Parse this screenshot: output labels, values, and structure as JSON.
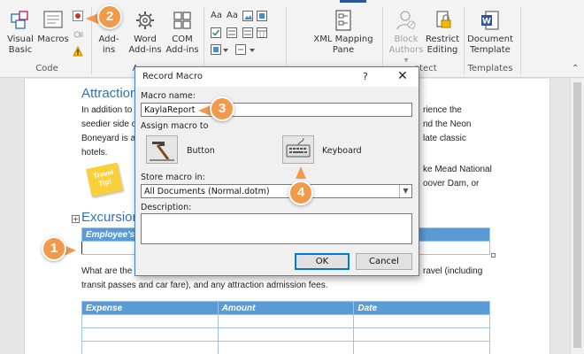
{
  "ribbon": {
    "code_group": {
      "label": "Code",
      "visual_basic": "Visual\nBasic",
      "macros": "Macros"
    },
    "addins_group": {
      "label": "A",
      "addins": "Add-\nins",
      "word_addins": "Word\nAdd-ins",
      "com_addins": "COM\nAdd-ins"
    },
    "xml_mapping": "XML Mapping\nPane",
    "protect_group": {
      "label": "otect",
      "block_authors": "Block\nAuthors ▾",
      "restrict_editing": "Restrict\nEditing"
    },
    "templates_group": {
      "label": "Templates",
      "document_template": "Document\nTemplate"
    }
  },
  "document": {
    "heading_attractions": "Attraction",
    "para1": [
      "In addition to",
      "seedier side o",
      "Boneyard is a",
      "hotels."
    ],
    "para1_right": [
      "rience the",
      "nd the Neon",
      "late classic"
    ],
    "para2_right": [
      "ke Mead National",
      "oover Dam, or"
    ],
    "sticky_note": "Travel\nTip!",
    "heading_excursions": "Excursion",
    "employee_header": "Employee's",
    "para3_line1_left": "What are the",
    "para3_line1_right": "ravel (including",
    "para3_line2": "transit passes and car fare), and any attraction admission fees.",
    "expense_table": {
      "headers": [
        "Expense",
        "Amount",
        "Date"
      ],
      "empty_rows": 4
    }
  },
  "dialog": {
    "title": "Record Macro",
    "help": "?",
    "close": "✕",
    "macro_name_label": "Macro name:",
    "macro_name_value": "KaylaReport",
    "assign_label": "Assign macro to",
    "button_label": "Button",
    "keyboard_label": "Keyboard",
    "store_label": "Store macro in:",
    "store_value": "All Documents (Normal.dotm)",
    "description_label": "Description:",
    "ok": "OK",
    "cancel": "Cancel"
  },
  "callouts": [
    "1",
    "2",
    "3",
    "4"
  ],
  "colors": {
    "accent_orange": "#f2994a",
    "word_blue": "#2b579a",
    "heading_blue": "#2e74b5",
    "table_header": "#5b9bd5"
  }
}
